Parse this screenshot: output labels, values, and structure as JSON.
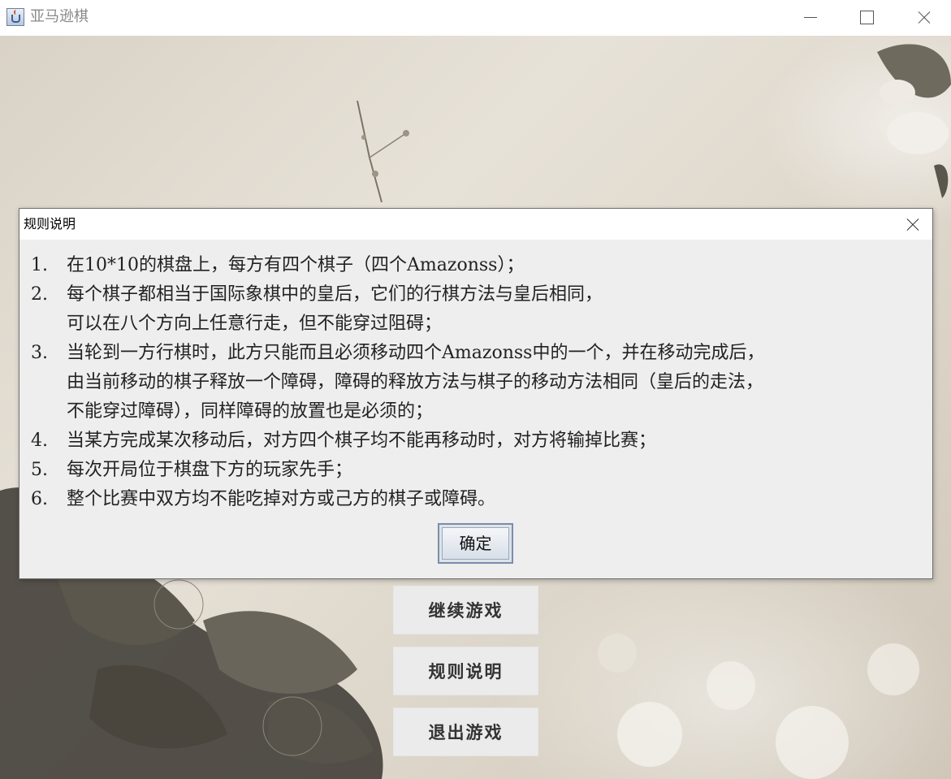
{
  "window": {
    "title": "亚马逊棋"
  },
  "menu": {
    "continue_label": "继续游戏",
    "rules_label": "规则说明",
    "exit_label": "退出游戏"
  },
  "dialog": {
    "title": "规则说明",
    "rules": [
      {
        "num": "1.",
        "lines": [
          "在10*10的棋盘上，每方有四个棋子（四个Amazonss）；"
        ]
      },
      {
        "num": "2.",
        "lines": [
          "每个棋子都相当于国际象棋中的皇后，它们的行棋方法与皇后相同，",
          "可以在八个方向上任意行走，但不能穿过阻碍；"
        ]
      },
      {
        "num": "3.",
        "lines": [
          "当轮到一方行棋时，此方只能而且必须移动四个Amazonss中的一个，并在移动完成后，",
          "由当前移动的棋子释放一个障碍，障碍的释放方法与棋子的移动方法相同（皇后的走法，",
          "不能穿过障碍），同样障碍的放置也是必须的；"
        ]
      },
      {
        "num": "4.",
        "lines": [
          "当某方完成某次移动后，对方四个棋子均不能再移动时，对方将输掉比赛；"
        ]
      },
      {
        "num": "5.",
        "lines": [
          "每次开局位于棋盘下方的玩家先手；"
        ]
      },
      {
        "num": "6.",
        "lines": [
          "整个比赛中双方均不能吃掉对方或己方的棋子或障碍。"
        ]
      }
    ],
    "ok_label": "确定"
  }
}
